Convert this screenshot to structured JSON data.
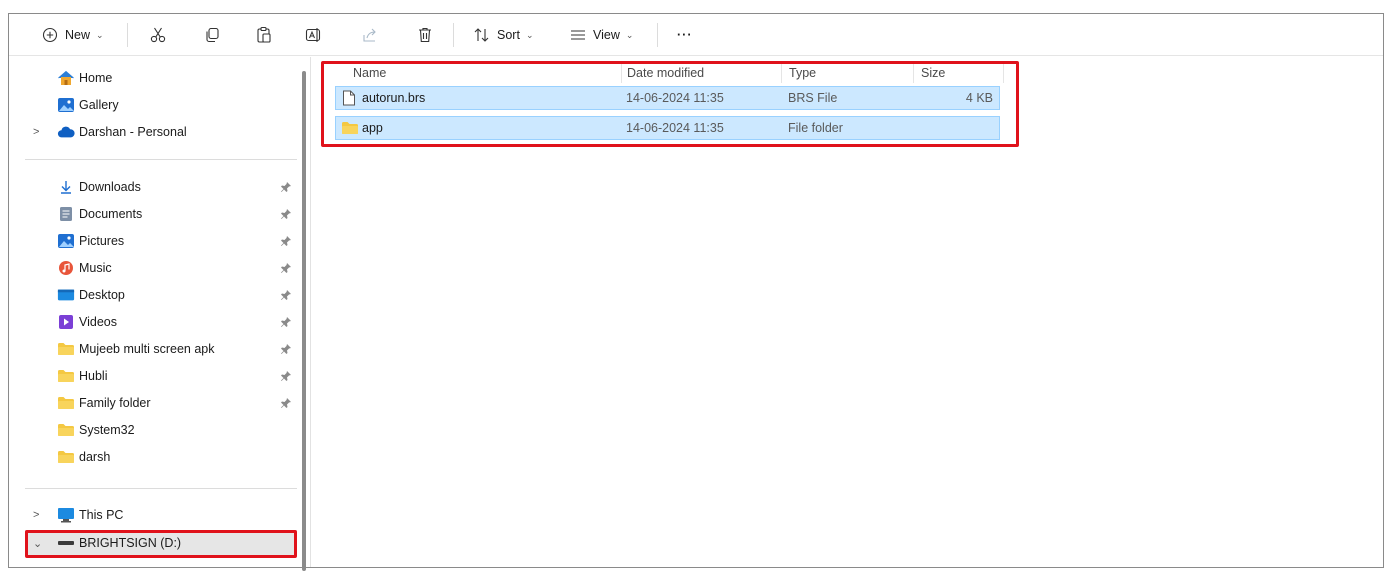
{
  "toolbar": {
    "new_label": "New",
    "sort_label": "Sort",
    "view_label": "View",
    "more_label": "···"
  },
  "nav": {
    "quick": [
      {
        "label": "Home",
        "icon": "home-icon"
      },
      {
        "label": "Gallery",
        "icon": "gallery-icon"
      },
      {
        "label": "Darshan - Personal",
        "icon": "onedrive-cloud-icon"
      }
    ],
    "pinned": [
      {
        "label": "Downloads",
        "icon": "download-icon"
      },
      {
        "label": "Documents",
        "icon": "documents-icon"
      },
      {
        "label": "Pictures",
        "icon": "pictures-icon"
      },
      {
        "label": "Music",
        "icon": "music-icon"
      },
      {
        "label": "Desktop",
        "icon": "desktop-icon"
      },
      {
        "label": "Videos",
        "icon": "videos-icon"
      },
      {
        "label": "Mujeeb multi screen apk",
        "icon": "folder-icon"
      },
      {
        "label": "Hubli",
        "icon": "folder-icon"
      },
      {
        "label": "Family folder",
        "icon": "folder-icon"
      },
      {
        "label": "System32",
        "icon": "folder-icon"
      },
      {
        "label": "darsh",
        "icon": "folder-icon"
      }
    ],
    "devices": [
      {
        "label": "This PC",
        "icon": "pc-icon"
      },
      {
        "label": "BRIGHTSIGN (D:)",
        "icon": "drive-icon"
      }
    ]
  },
  "columns": {
    "name": "Name",
    "date": "Date modified",
    "type": "Type",
    "size": "Size"
  },
  "files": [
    {
      "name": "autorun.brs",
      "date": "14-06-2024 11:35",
      "type": "BRS File",
      "size": "4 KB",
      "icon": "file-icon"
    },
    {
      "name": "app",
      "date": "14-06-2024 11:35",
      "type": "File folder",
      "size": "",
      "icon": "folder-icon"
    }
  ],
  "colors": {
    "selection": "#cce8ff",
    "highlight_box": "#e0121b",
    "folder": "#f4c842"
  }
}
